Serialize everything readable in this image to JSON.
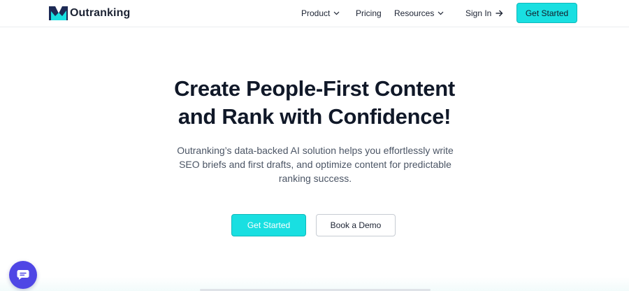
{
  "brand": {
    "name": "Outranking",
    "logo_icon": "outranking-logo-icon"
  },
  "nav": {
    "product": "Product",
    "pricing": "Pricing",
    "resources": "Resources",
    "sign_in": "Sign In",
    "get_started": "Get Started"
  },
  "hero": {
    "title_line1": "Create People-First Content",
    "title_line2": "and Rank with Confidence!",
    "subtitle": "Outranking’s data-backed AI solution helps you effortlessly write SEO briefs and first drafts, and optimize content for predictable ranking success.",
    "primary_cta": "Get Started",
    "secondary_cta": "Book a Demo"
  },
  "chat_widget": {
    "icon": "chat-bubble-icon"
  },
  "colors": {
    "accent": "#19dfe1",
    "logo_dark": "#1d2a55",
    "chat_button": "#4f46e5",
    "heading": "#101828",
    "body_text": "#4b5565"
  }
}
